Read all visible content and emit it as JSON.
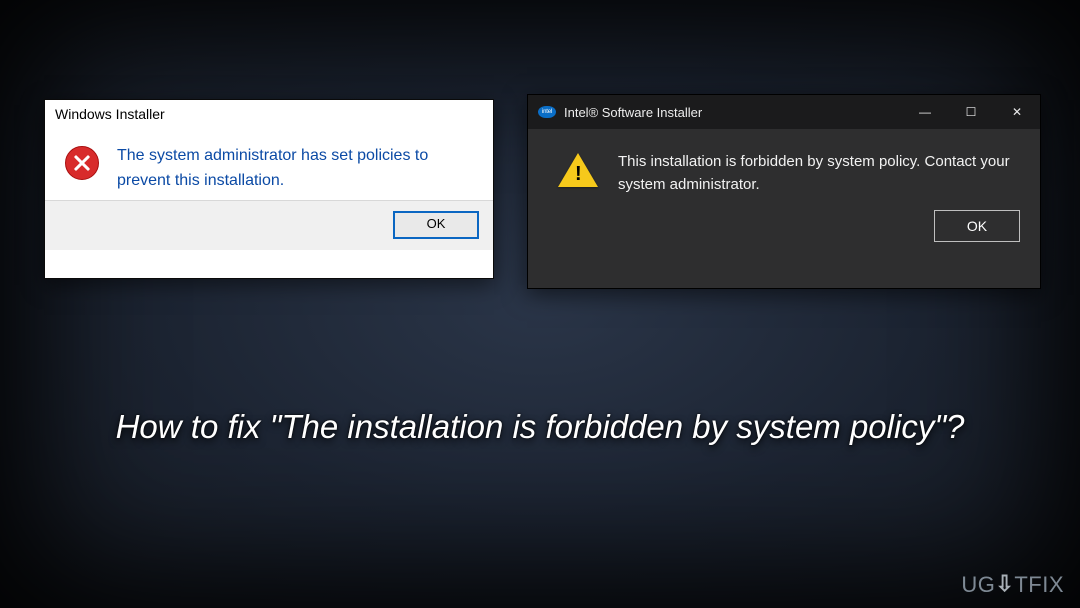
{
  "dialog_light": {
    "title": "Windows Installer",
    "message": "The system administrator has set policies to prevent this installation.",
    "ok_label": "OK",
    "icon": "error-icon"
  },
  "dialog_dark": {
    "title": "Intel® Software Installer",
    "message": "This installation is forbidden by system policy. Contact your system administrator.",
    "ok_label": "OK",
    "icon": "warning-icon",
    "logo": "intel-logo",
    "window_controls": {
      "minimize": "—",
      "maximize": "☐",
      "close": "✕"
    }
  },
  "headline": "How to fix \"The installation is forbidden by system policy\"?",
  "watermark": {
    "prefix": "UG",
    "mid": "⇩",
    "suffix": "TFIX"
  }
}
